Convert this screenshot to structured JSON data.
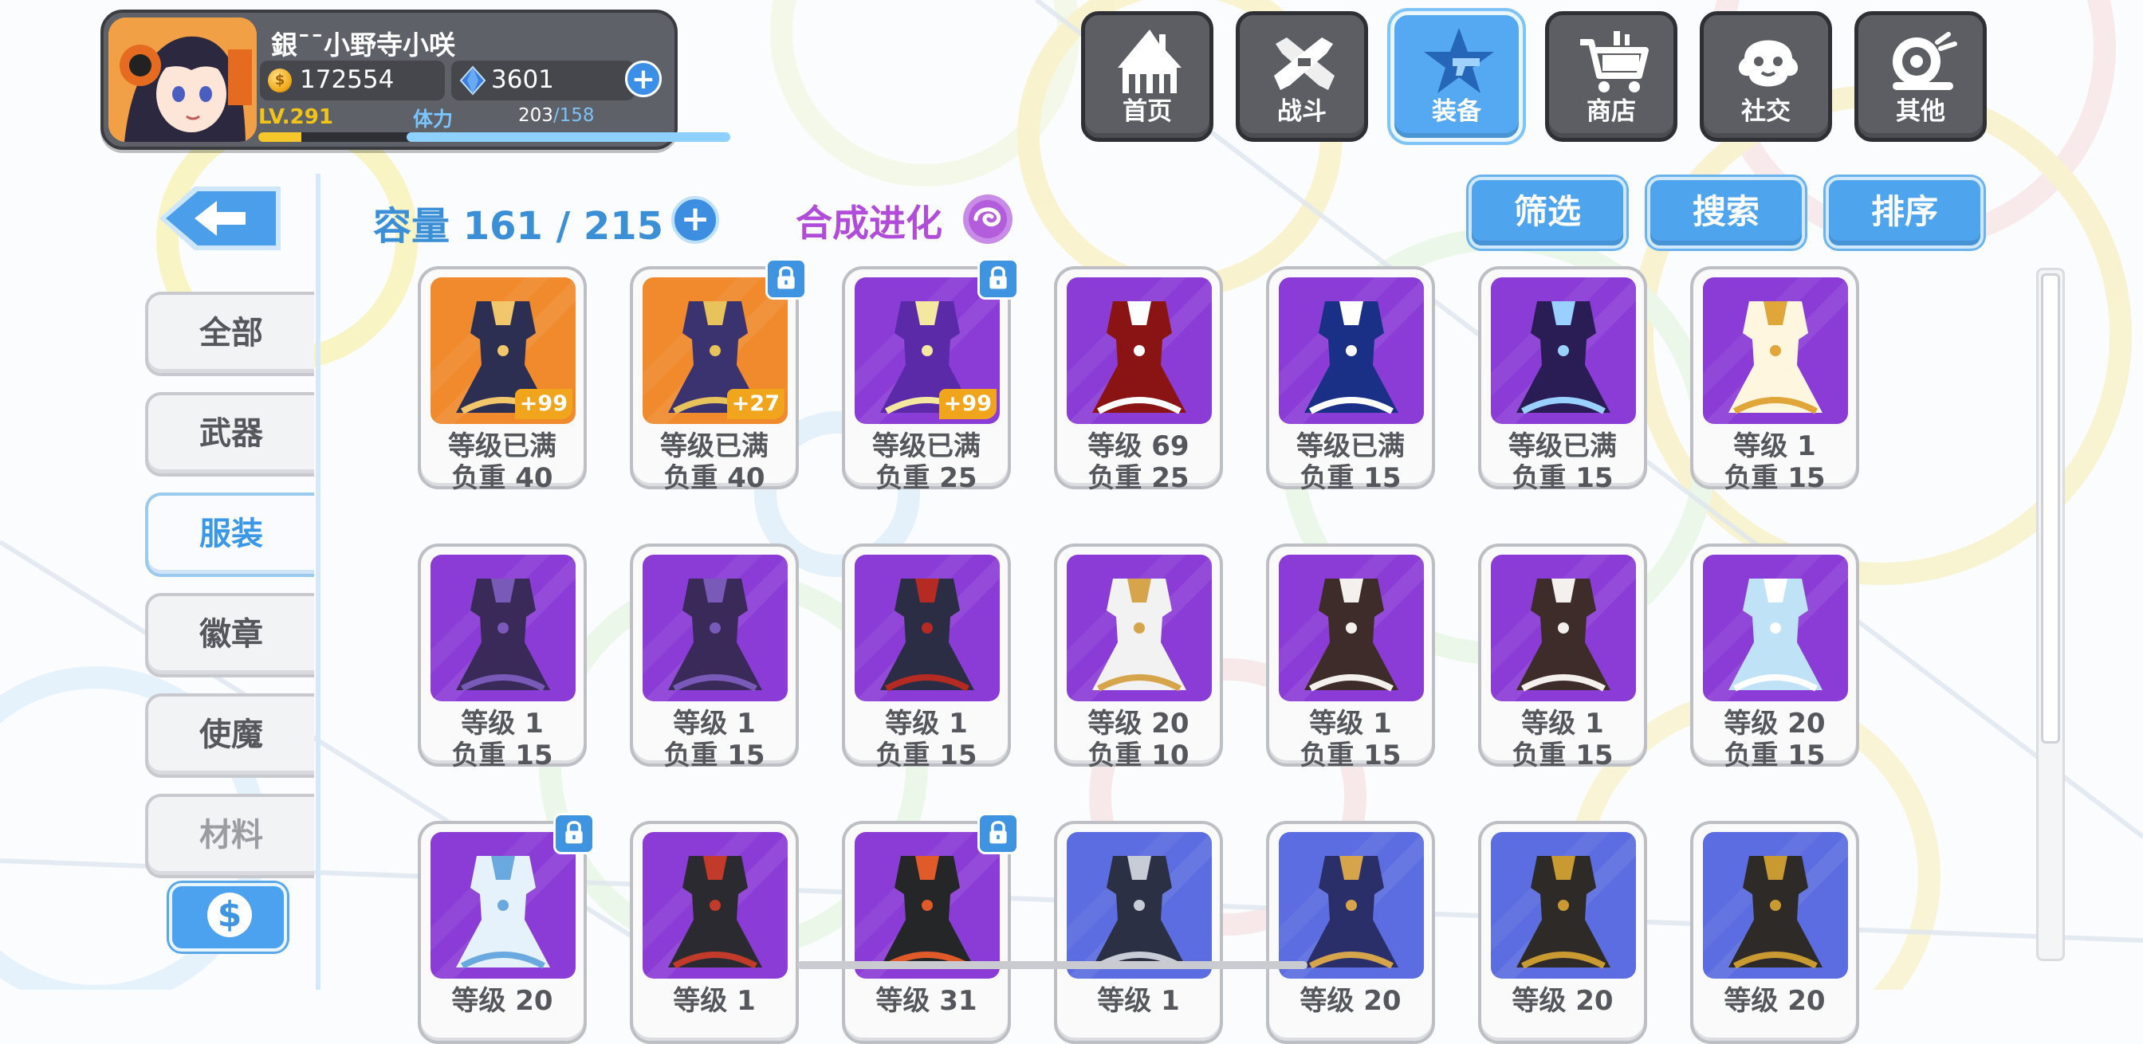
{
  "player": {
    "name": "銀¯¯小野寺小咲",
    "coins": "172554",
    "gems": "3601",
    "level": "LV.291",
    "level_progress": 0.2,
    "stamina_label": "体力",
    "stamina_current": "203",
    "stamina_max": "/158"
  },
  "nav": [
    {
      "label": "首页",
      "icon": "house-icon",
      "active": false
    },
    {
      "label": "战斗",
      "icon": "crossed-guns-icon",
      "active": false
    },
    {
      "label": "装备",
      "icon": "star-gun-icon",
      "active": true
    },
    {
      "label": "商店",
      "icon": "shopping-cart-icon",
      "active": false
    },
    {
      "label": "社交",
      "icon": "ghost-face-icon",
      "active": false
    },
    {
      "label": "其他",
      "icon": "snail-icon",
      "active": false
    }
  ],
  "categories": [
    {
      "label": "全部",
      "active": false
    },
    {
      "label": "武器",
      "active": false
    },
    {
      "label": "服装",
      "active": true
    },
    {
      "label": "徽章",
      "active": false
    },
    {
      "label": "使魔",
      "active": false
    },
    {
      "label": "材料",
      "active": false
    }
  ],
  "inventory": {
    "capacity_label": "容量 161 / 215",
    "synth_label": "合成进化"
  },
  "tools": {
    "filter": "筛选",
    "search": "搜索",
    "sort": "排序"
  },
  "items": [
    {
      "level": "等级已满",
      "weight": "负重 40",
      "badge": "+99",
      "locked": false,
      "bg": "#f08a2c",
      "outfit": "#2c2f52",
      "accent": "#f2c66a"
    },
    {
      "level": "等级已满",
      "weight": "负重 40",
      "badge": "+27",
      "locked": true,
      "bg": "#f08a2c",
      "outfit": "#3b3370",
      "accent": "#e8c25a"
    },
    {
      "level": "等级已满",
      "weight": "负重 25",
      "badge": "+99",
      "locked": true,
      "bg": "#8b3cd6",
      "outfit": "#5a2aa8",
      "accent": "#f4e7a0"
    },
    {
      "level": "等级 69",
      "weight": "负重 25",
      "badge": "",
      "locked": false,
      "bg": "#8b3cd6",
      "outfit": "#8a1414",
      "accent": "#ffffff"
    },
    {
      "level": "等级已满",
      "weight": "负重 15",
      "badge": "",
      "locked": false,
      "bg": "#8b3cd6",
      "outfit": "#1a2f86",
      "accent": "#ffffff"
    },
    {
      "level": "等级已满",
      "weight": "负重 15",
      "badge": "",
      "locked": false,
      "bg": "#8b3cd6",
      "outfit": "#2a1d55",
      "accent": "#9ad0ff"
    },
    {
      "level": "等级 1",
      "weight": "负重 15",
      "badge": "",
      "locked": false,
      "bg": "#8b3cd6",
      "outfit": "#fff6e0",
      "accent": "#e0a63a"
    },
    {
      "level": "等级 1",
      "weight": "负重 15",
      "badge": "",
      "locked": false,
      "bg": "#8b3cd6",
      "outfit": "#3a2a5a",
      "accent": "#7a5ab8"
    },
    {
      "level": "等级 1",
      "weight": "负重 15",
      "badge": "",
      "locked": false,
      "bg": "#8b3cd6",
      "outfit": "#3a2a5a",
      "accent": "#7a5ab8"
    },
    {
      "level": "等级 1",
      "weight": "负重 15",
      "badge": "",
      "locked": false,
      "bg": "#8b3cd6",
      "outfit": "#2a2d44",
      "accent": "#b52a22"
    },
    {
      "level": "等级 20",
      "weight": "负重 10",
      "badge": "",
      "locked": false,
      "bg": "#8b3cd6",
      "outfit": "#f2f2f2",
      "accent": "#d6a44a"
    },
    {
      "level": "等级 1",
      "weight": "负重 15",
      "badge": "",
      "locked": false,
      "bg": "#8b3cd6",
      "outfit": "#3e2c2a",
      "accent": "#f4f0ee"
    },
    {
      "level": "等级 1",
      "weight": "负重 15",
      "badge": "",
      "locked": false,
      "bg": "#8b3cd6",
      "outfit": "#3e2c2a",
      "accent": "#f4f0ee"
    },
    {
      "level": "等级 20",
      "weight": "负重 15",
      "badge": "",
      "locked": false,
      "bg": "#8b3cd6",
      "outfit": "#bfe2f6",
      "accent": "#ffffff"
    },
    {
      "level": "等级 20",
      "weight": "",
      "badge": "",
      "locked": true,
      "bg": "#8b3cd6",
      "outfit": "#e6f2fb",
      "accent": "#6aa8e0"
    },
    {
      "level": "等级 1",
      "weight": "",
      "badge": "",
      "locked": false,
      "bg": "#8b3cd6",
      "outfit": "#2a2a30",
      "accent": "#c23a2a"
    },
    {
      "level": "等级 31",
      "weight": "",
      "badge": "",
      "locked": true,
      "bg": "#8b3cd6",
      "outfit": "#242628",
      "accent": "#e05a2a"
    },
    {
      "level": "等级 1",
      "weight": "",
      "badge": "",
      "locked": false,
      "bg": "#5b6de0",
      "outfit": "#2c3044",
      "accent": "#c8ccd6"
    },
    {
      "level": "等级 20",
      "weight": "",
      "badge": "",
      "locked": false,
      "bg": "#5b6de0",
      "outfit": "#2a2f6a",
      "accent": "#d6a44a"
    },
    {
      "level": "等级 20",
      "weight": "",
      "badge": "",
      "locked": false,
      "bg": "#5b6de0",
      "outfit": "#2e2a28",
      "accent": "#c99a32"
    },
    {
      "level": "等级 20",
      "weight": "",
      "badge": "",
      "locked": false,
      "bg": "#5b6de0",
      "outfit": "#2e2a28",
      "accent": "#c99a32"
    }
  ]
}
